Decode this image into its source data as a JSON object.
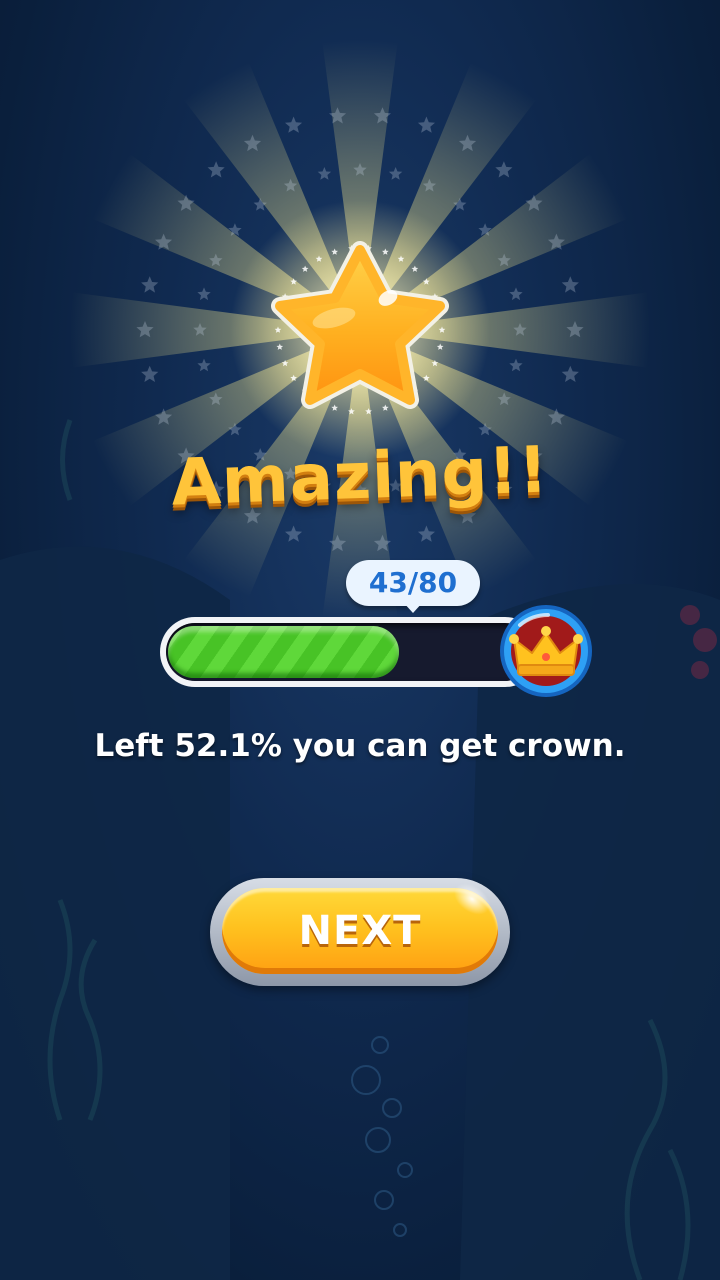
{
  "result": {
    "title": "Amazing!!",
    "stars_earned": 1
  },
  "progress": {
    "label": "43/80",
    "current": 43,
    "total": 80,
    "fraction": 0.5375
  },
  "reward": {
    "icon": "crown-icon"
  },
  "hint_text": "Left 52.1% you can get crown.",
  "next_button": {
    "label": "NEXT"
  },
  "colors": {
    "title": "#ffc43a",
    "progress_fill": "#5fd83a",
    "button": "#ffc21f",
    "badge": "#2196f3",
    "background": "#102a50"
  }
}
